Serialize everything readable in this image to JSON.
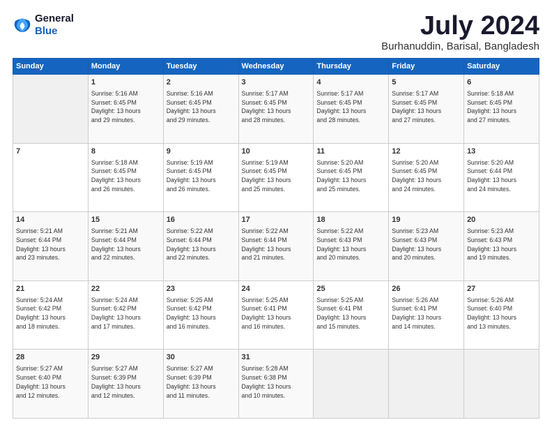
{
  "header": {
    "logo_line1": "General",
    "logo_line2": "Blue",
    "month": "July 2024",
    "location": "Burhanuddin, Barisal, Bangladesh"
  },
  "days_of_week": [
    "Sunday",
    "Monday",
    "Tuesday",
    "Wednesday",
    "Thursday",
    "Friday",
    "Saturday"
  ],
  "weeks": [
    [
      {
        "day": "",
        "info": ""
      },
      {
        "day": "1",
        "info": "Sunrise: 5:16 AM\nSunset: 6:45 PM\nDaylight: 13 hours\nand 29 minutes."
      },
      {
        "day": "2",
        "info": "Sunrise: 5:16 AM\nSunset: 6:45 PM\nDaylight: 13 hours\nand 29 minutes."
      },
      {
        "day": "3",
        "info": "Sunrise: 5:17 AM\nSunset: 6:45 PM\nDaylight: 13 hours\nand 28 minutes."
      },
      {
        "day": "4",
        "info": "Sunrise: 5:17 AM\nSunset: 6:45 PM\nDaylight: 13 hours\nand 28 minutes."
      },
      {
        "day": "5",
        "info": "Sunrise: 5:17 AM\nSunset: 6:45 PM\nDaylight: 13 hours\nand 27 minutes."
      },
      {
        "day": "6",
        "info": "Sunrise: 5:18 AM\nSunset: 6:45 PM\nDaylight: 13 hours\nand 27 minutes."
      }
    ],
    [
      {
        "day": "7",
        "info": ""
      },
      {
        "day": "8",
        "info": "Sunrise: 5:18 AM\nSunset: 6:45 PM\nDaylight: 13 hours\nand 26 minutes."
      },
      {
        "day": "9",
        "info": "Sunrise: 5:19 AM\nSunset: 6:45 PM\nDaylight: 13 hours\nand 26 minutes."
      },
      {
        "day": "10",
        "info": "Sunrise: 5:19 AM\nSunset: 6:45 PM\nDaylight: 13 hours\nand 25 minutes."
      },
      {
        "day": "11",
        "info": "Sunrise: 5:20 AM\nSunset: 6:45 PM\nDaylight: 13 hours\nand 25 minutes."
      },
      {
        "day": "12",
        "info": "Sunrise: 5:20 AM\nSunset: 6:45 PM\nDaylight: 13 hours\nand 24 minutes."
      },
      {
        "day": "13",
        "info": "Sunrise: 5:20 AM\nSunset: 6:44 PM\nDaylight: 13 hours\nand 24 minutes."
      }
    ],
    [
      {
        "day": "14",
        "info": ""
      },
      {
        "day": "15",
        "info": "Sunrise: 5:21 AM\nSunset: 6:44 PM\nDaylight: 13 hours\nand 22 minutes."
      },
      {
        "day": "16",
        "info": "Sunrise: 5:22 AM\nSunset: 6:44 PM\nDaylight: 13 hours\nand 22 minutes."
      },
      {
        "day": "17",
        "info": "Sunrise: 5:22 AM\nSunset: 6:44 PM\nDaylight: 13 hours\nand 21 minutes."
      },
      {
        "day": "18",
        "info": "Sunrise: 5:22 AM\nSunset: 6:43 PM\nDaylight: 13 hours\nand 20 minutes."
      },
      {
        "day": "19",
        "info": "Sunrise: 5:23 AM\nSunset: 6:43 PM\nDaylight: 13 hours\nand 20 minutes."
      },
      {
        "day": "20",
        "info": "Sunrise: 5:23 AM\nSunset: 6:43 PM\nDaylight: 13 hours\nand 19 minutes."
      }
    ],
    [
      {
        "day": "21",
        "info": ""
      },
      {
        "day": "22",
        "info": "Sunrise: 5:24 AM\nSunset: 6:42 PM\nDaylight: 13 hours\nand 17 minutes."
      },
      {
        "day": "23",
        "info": "Sunrise: 5:25 AM\nSunset: 6:42 PM\nDaylight: 13 hours\nand 16 minutes."
      },
      {
        "day": "24",
        "info": "Sunrise: 5:25 AM\nSunset: 6:41 PM\nDaylight: 13 hours\nand 16 minutes."
      },
      {
        "day": "25",
        "info": "Sunrise: 5:25 AM\nSunset: 6:41 PM\nDaylight: 13 hours\nand 15 minutes."
      },
      {
        "day": "26",
        "info": "Sunrise: 5:26 AM\nSunset: 6:41 PM\nDaylight: 13 hours\nand 14 minutes."
      },
      {
        "day": "27",
        "info": "Sunrise: 5:26 AM\nSunset: 6:40 PM\nDaylight: 13 hours\nand 13 minutes."
      }
    ],
    [
      {
        "day": "28",
        "info": "Sunrise: 5:27 AM\nSunset: 6:40 PM\nDaylight: 13 hours\nand 12 minutes."
      },
      {
        "day": "29",
        "info": "Sunrise: 5:27 AM\nSunset: 6:39 PM\nDaylight: 13 hours\nand 12 minutes."
      },
      {
        "day": "30",
        "info": "Sunrise: 5:27 AM\nSunset: 6:39 PM\nDaylight: 13 hours\nand 11 minutes."
      },
      {
        "day": "31",
        "info": "Sunrise: 5:28 AM\nSunset: 6:38 PM\nDaylight: 13 hours\nand 10 minutes."
      },
      {
        "day": "",
        "info": ""
      },
      {
        "day": "",
        "info": ""
      },
      {
        "day": "",
        "info": ""
      }
    ]
  ],
  "week1_sun_info": "Sunrise: 5:18 AM\nSunset: 6:45 PM\nDaylight: 13 hours\nand 27 minutes.",
  "week3_sun_info": "Sunrise: 5:21 AM\nSunset: 6:44 PM\nDaylight: 13 hours\nand 23 minutes.",
  "week4_sun_info": "Sunrise: 5:24 AM\nSunset: 6:42 PM\nDaylight: 13 hours\nand 18 minutes."
}
